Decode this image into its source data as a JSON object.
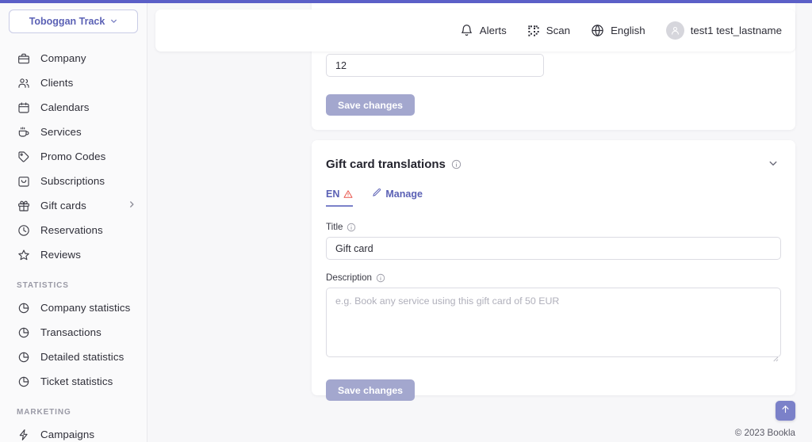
{
  "theme": {
    "accent": "#5b61b5",
    "accent_light": "#7b81c9",
    "button_muted": "#a3a7ce",
    "warning": "#e8544a",
    "page_bg": "#f7f7f9",
    "sidebar_bg": "#fafafb"
  },
  "sidebar": {
    "org_switcher": {
      "label": "Toboggan Track",
      "chevron": "chevron-down-icon"
    },
    "items": [
      {
        "label": "Company",
        "icon": "briefcase-icon",
        "has_submenu": false
      },
      {
        "label": "Clients",
        "icon": "users-icon",
        "has_submenu": false
      },
      {
        "label": "Calendars",
        "icon": "calendar-icon",
        "has_submenu": false
      },
      {
        "label": "Services",
        "icon": "coffee-cup-icon",
        "has_submenu": false
      },
      {
        "label": "Promo Codes",
        "icon": "tag-icon",
        "has_submenu": false
      },
      {
        "label": "Subscriptions",
        "icon": "bag-icon",
        "has_submenu": false
      },
      {
        "label": "Gift cards",
        "icon": "gift-icon",
        "has_submenu": true
      },
      {
        "label": "Reservations",
        "icon": "clock-icon",
        "has_submenu": false
      },
      {
        "label": "Reviews",
        "icon": "star-icon",
        "has_submenu": false
      }
    ],
    "sections": [
      {
        "title": "STATISTICS",
        "items": [
          {
            "label": "Company statistics",
            "icon": "pie-chart-icon"
          },
          {
            "label": "Transactions",
            "icon": "pie-chart-icon"
          },
          {
            "label": "Detailed statistics",
            "icon": "pie-chart-icon"
          },
          {
            "label": "Ticket statistics",
            "icon": "pie-chart-icon"
          }
        ]
      },
      {
        "title": "MARKETING",
        "items": [
          {
            "label": "Campaigns",
            "icon": "lightning-icon"
          }
        ]
      }
    ]
  },
  "topbar": {
    "alerts": {
      "label": "Alerts",
      "icon": "bell-icon"
    },
    "scan": {
      "label": "Scan",
      "icon": "qr-code-icon"
    },
    "language": {
      "label": "English",
      "icon": "globe-icon"
    },
    "user": {
      "name": "test1 test_lastname",
      "icon": "user-avatar-icon"
    }
  },
  "cards": {
    "top_card": {
      "input_value": "12",
      "save_label": "Save changes"
    },
    "translations": {
      "title": "Gift card translations",
      "title_info_icon": "info-icon",
      "collapse_icon": "chevron-down-icon",
      "tabs": [
        {
          "label": "EN",
          "active": true,
          "warning_icon": "warning-triangle-icon"
        },
        {
          "label": "Manage",
          "active": false,
          "icon": "pencil-icon"
        }
      ],
      "title_field": {
        "label": "Title",
        "info_icon": "info-icon",
        "value": "Gift card",
        "placeholder": ""
      },
      "description_field": {
        "label": "Description",
        "info_icon": "info-icon",
        "value": "",
        "placeholder": "e.g. Book any service using this gift card of 50 EUR"
      },
      "save_label": "Save changes"
    }
  },
  "footer": {
    "copyright": "© 2023 Bookla",
    "scroll_top_icon": "arrow-up-icon"
  }
}
